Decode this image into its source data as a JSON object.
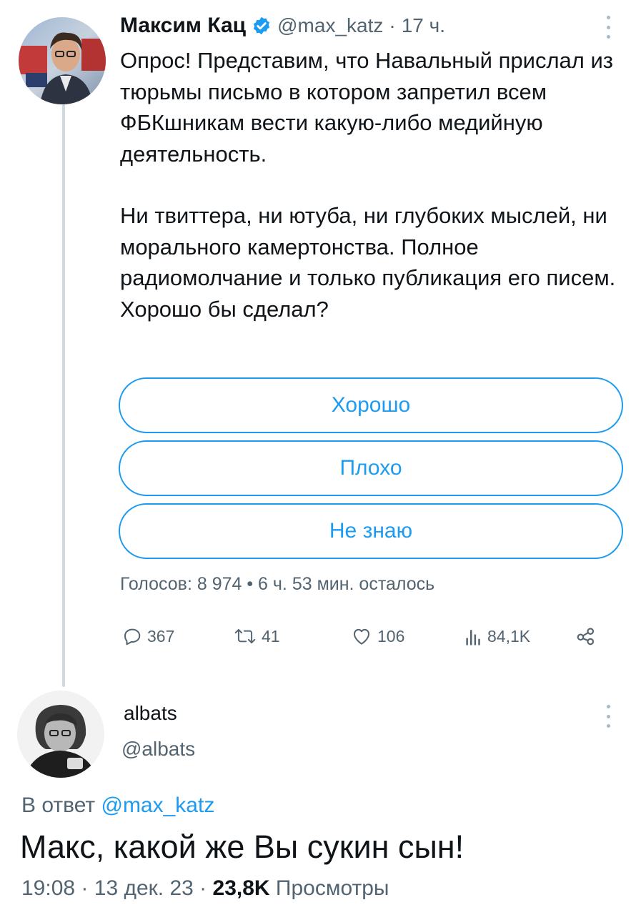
{
  "tweet": {
    "author_name": "Максим Кац",
    "author_handle": "@max_katz",
    "separator": "·",
    "time_ago": "17 ч.",
    "text_paragraph_1": "Опрос! Представим, что Навальный прислал из тюрьмы письмо в котором запретил всем ФБКшникам вести какую-либо медийную деятельность.",
    "text_paragraph_2": "Ни твиттера, ни ютуба, ни глубоких мыслей, ни морального камертонства. Полное радиомолчание и только публикация его писем. Хорошо бы сделал?",
    "poll": {
      "options": [
        "Хорошо",
        "Плохо",
        "Не знаю"
      ],
      "summary": "Голосов: 8 974 • 6 ч. 53 мин. осталось"
    },
    "actions": {
      "replies": "367",
      "retweets": "41",
      "likes": "106",
      "views": "84,1K"
    },
    "icons": [
      "verified-badge-icon",
      "more-icon",
      "reply-icon",
      "retweet-icon",
      "like-icon",
      "views-icon",
      "share-icon"
    ]
  },
  "reply": {
    "author_name": "albats",
    "author_handle": "@albats",
    "replying_to_prefix": "В ответ",
    "replying_to_mention": "@max_katz",
    "text": "Макс, какой же Вы сукин сын!",
    "time": "19:08",
    "separator": "·",
    "date": "13 дек. 23",
    "views_count": "23,8K",
    "views_label": "Просмотры"
  },
  "colors": {
    "accent": "#1d9bf0",
    "text": "#0f1419",
    "secondary": "#536471",
    "thread_line": "#cfd9de"
  }
}
